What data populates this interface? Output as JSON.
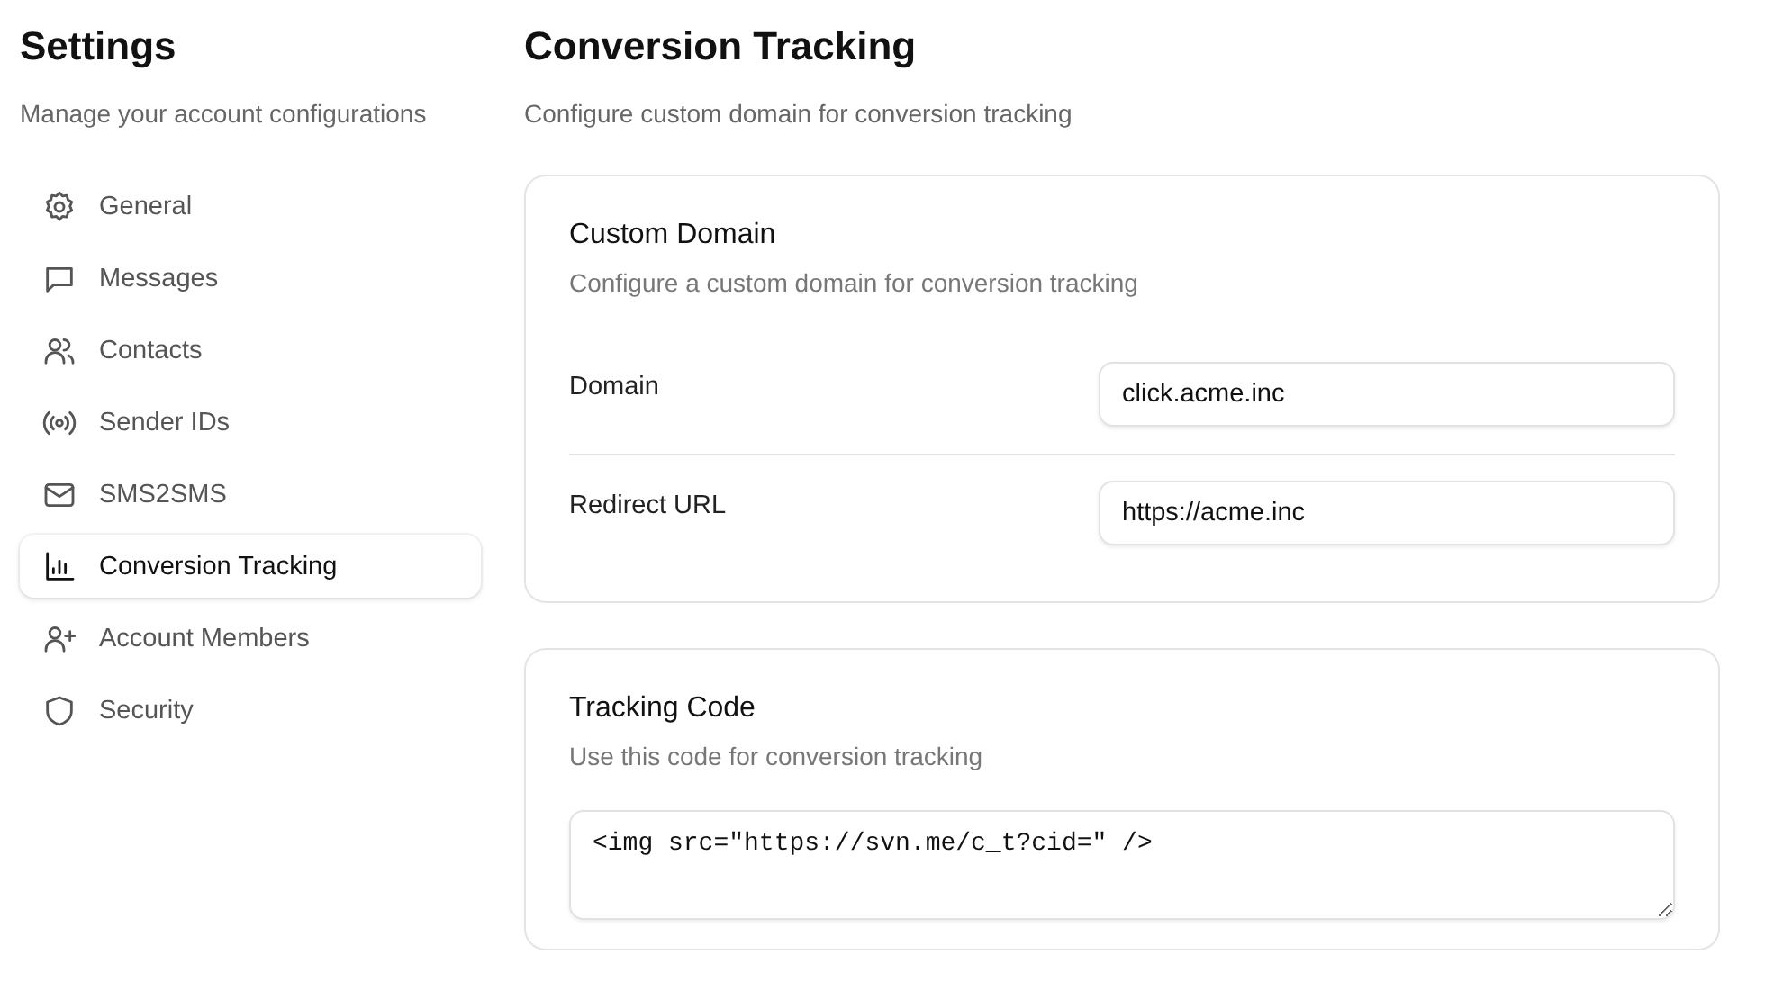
{
  "sidebar": {
    "title": "Settings",
    "subtitle": "Manage your account configurations",
    "items": [
      {
        "label": "General",
        "selected": false
      },
      {
        "label": "Messages",
        "selected": false
      },
      {
        "label": "Contacts",
        "selected": false
      },
      {
        "label": "Sender IDs",
        "selected": false
      },
      {
        "label": "SMS2SMS",
        "selected": false
      },
      {
        "label": "Conversion Tracking",
        "selected": true
      },
      {
        "label": "Account Members",
        "selected": false
      },
      {
        "label": "Security",
        "selected": false
      }
    ]
  },
  "page": {
    "title": "Conversion Tracking",
    "subtitle": "Configure custom domain for conversion tracking"
  },
  "custom_domain": {
    "title": "Custom Domain",
    "description": "Configure a custom domain for conversion tracking",
    "fields": [
      {
        "label": "Domain",
        "value": "click.acme.inc"
      },
      {
        "label": "Redirect URL",
        "value": "https://acme.inc"
      }
    ]
  },
  "tracking_code": {
    "title": "Tracking Code",
    "description": "Use this code for conversion tracking",
    "code": "<img src=\"https://svn.me/c_t?cid=\" />"
  }
}
